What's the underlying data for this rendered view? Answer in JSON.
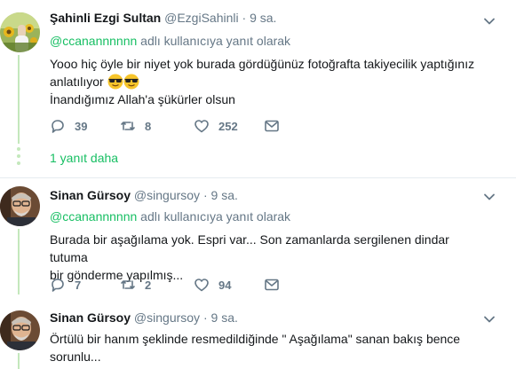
{
  "tweets": [
    {
      "name": "Şahinli Ezgi Sultan",
      "handle": "@EzgiSahinli",
      "separator": "·",
      "time": "9 sa.",
      "reply_to_handle": "@ccanannnnnn",
      "reply_to_suffix": " adlı kullanıcıya yanıt olarak",
      "text_line1": "Yooo hiç öyle bir niyet yok burada gördüğünüz fotoğrafta takiyecilik yaptığınız",
      "text_line2": "anlatılıyor",
      "text_line3": "İnandığımız Allah'a şükürler olsun",
      "emoji": "smiling-face-with-sunglasses",
      "replies": "39",
      "retweets": "8",
      "likes": "252",
      "more_replies": "1 yanıt daha"
    },
    {
      "name": "Sinan Gürsoy",
      "handle": "@singursoy",
      "separator": "·",
      "time": "9 sa.",
      "reply_to_handle": "@ccanannnnnn",
      "reply_to_suffix": " adlı kullanıcıya yanıt olarak",
      "text_line1": "Burada bir aşağılama yok. Espri var... Son zamanlarda sergilenen dindar tutuma",
      "text_line2": "bir gönderme yapılmış...",
      "replies": "7",
      "retweets": "2",
      "likes": "94"
    },
    {
      "name": "Sinan Gürsoy",
      "handle": "@singursoy",
      "separator": "·",
      "time": "9 sa.",
      "text_line1": "Örtülü bir hanım şeklinde resmedildiğinde \" Aşağılama\" sanan bakış bence",
      "text_line2": "sorunlu..."
    }
  ],
  "colors": {
    "accent_green": "#17bf63",
    "thread_line": "#c4e8bc",
    "muted": "#657786"
  },
  "icons": [
    "chevron-down-icon",
    "reply-icon",
    "retweet-icon",
    "like-icon",
    "message-icon"
  ]
}
